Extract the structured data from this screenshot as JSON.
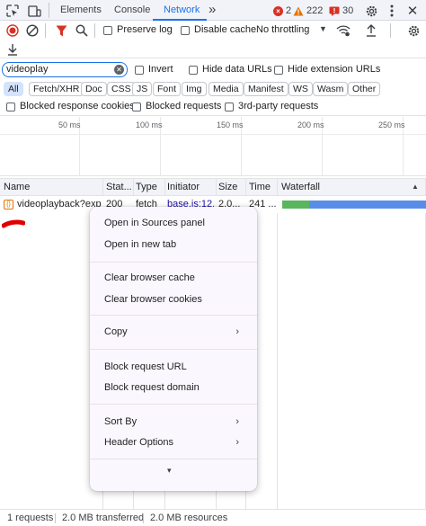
{
  "tabs": {
    "elements": "Elements",
    "console": "Console",
    "network": "Network",
    "more": "»"
  },
  "counts": {
    "errors": "2",
    "warnings": "222",
    "issues": "30"
  },
  "toolbar": {
    "preserve_log": "Preserve log",
    "disable_cache": "Disable cache",
    "throttling": "No throttling"
  },
  "filter": {
    "value": "videoplay",
    "invert": "Invert",
    "hide_data_urls": "Hide data URLs",
    "hide_extension_urls": "Hide extension URLs"
  },
  "types": [
    "All",
    "Fetch/XHR",
    "Doc",
    "CSS",
    "JS",
    "Font",
    "Img",
    "Media",
    "Manifest",
    "WS",
    "Wasm",
    "Other"
  ],
  "blocking": {
    "blocked_cookies": "Blocked response cookies",
    "blocked_requests": "Blocked requests",
    "third_party": "3rd-party requests"
  },
  "overview_ticks": [
    "50 ms",
    "100 ms",
    "150 ms",
    "200 ms",
    "250 ms"
  ],
  "columns": {
    "name": "Name",
    "status": "Stat...",
    "type": "Type",
    "initiator": "Initiator",
    "size": "Size",
    "time": "Time",
    "waterfall": "Waterfall"
  },
  "request": {
    "name": "videoplayback?exp",
    "status": "200",
    "type": "fetch",
    "initiator": "base.js:12...",
    "size": "2.0...",
    "time": "241 ..."
  },
  "context_menu": {
    "open_sources": "Open in Sources panel",
    "open_new_tab": "Open in new tab",
    "clear_cache": "Clear browser cache",
    "clear_cookies": "Clear browser cookies",
    "copy": "Copy",
    "block_url": "Block request URL",
    "block_domain": "Block request domain",
    "sort_by": "Sort By",
    "header_options": "Header Options",
    "more": "▾"
  },
  "statusbar": {
    "requests": "1 requests",
    "transferred": "2.0 MB transferred",
    "resources": "2.0 MB resources"
  },
  "colors": {
    "accent": "#1a73e8",
    "error": "#d93025",
    "warning": "#e37400",
    "record": "#d93025",
    "waterfall_wait": "#5ab55e",
    "waterfall_download": "#5a8de8"
  }
}
